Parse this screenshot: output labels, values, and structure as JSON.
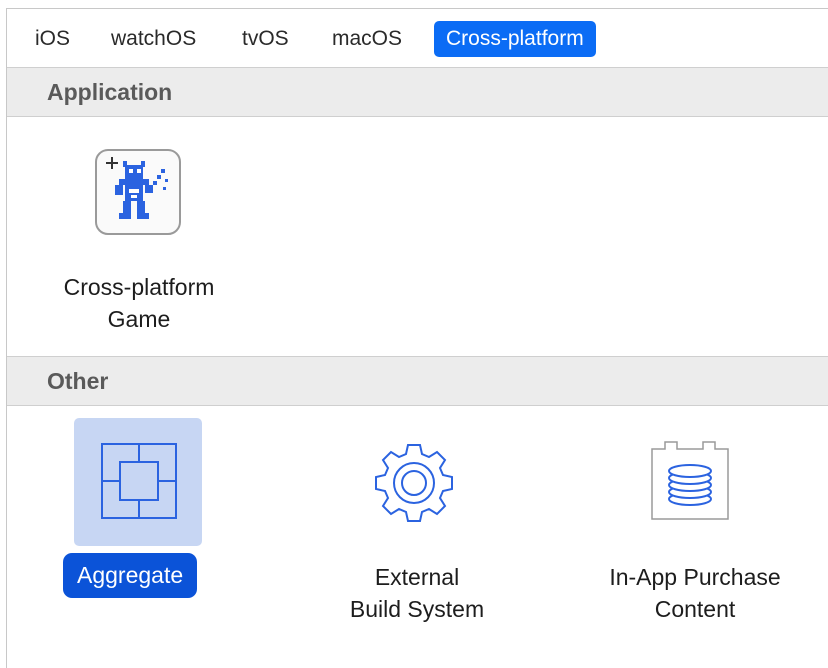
{
  "tabs": [
    {
      "label": "iOS",
      "selected": false
    },
    {
      "label": "watchOS",
      "selected": false
    },
    {
      "label": "tvOS",
      "selected": false
    },
    {
      "label": "macOS",
      "selected": false
    },
    {
      "label": "Cross-platform",
      "selected": true
    }
  ],
  "sections": [
    {
      "title": "Application",
      "templates": [
        {
          "label": "Cross-platform\nGame",
          "icon": "game-sprite-icon",
          "selected": false
        }
      ]
    },
    {
      "title": "Other",
      "templates": [
        {
          "label": "Aggregate",
          "icon": "aggregate-icon",
          "selected": true
        },
        {
          "label": "External\nBuild System",
          "icon": "gear-icon",
          "selected": false
        },
        {
          "label": "In-App Purchase\nContent",
          "icon": "in-app-purchase-icon",
          "selected": false
        }
      ]
    }
  ],
  "colors": {
    "accent": "#0b6cf5",
    "selected_label_bg": "#0b53d8",
    "selected_tile_bg": "#c7d6f3",
    "icon_blue": "#2b63e0",
    "header_bg": "#ececec"
  }
}
